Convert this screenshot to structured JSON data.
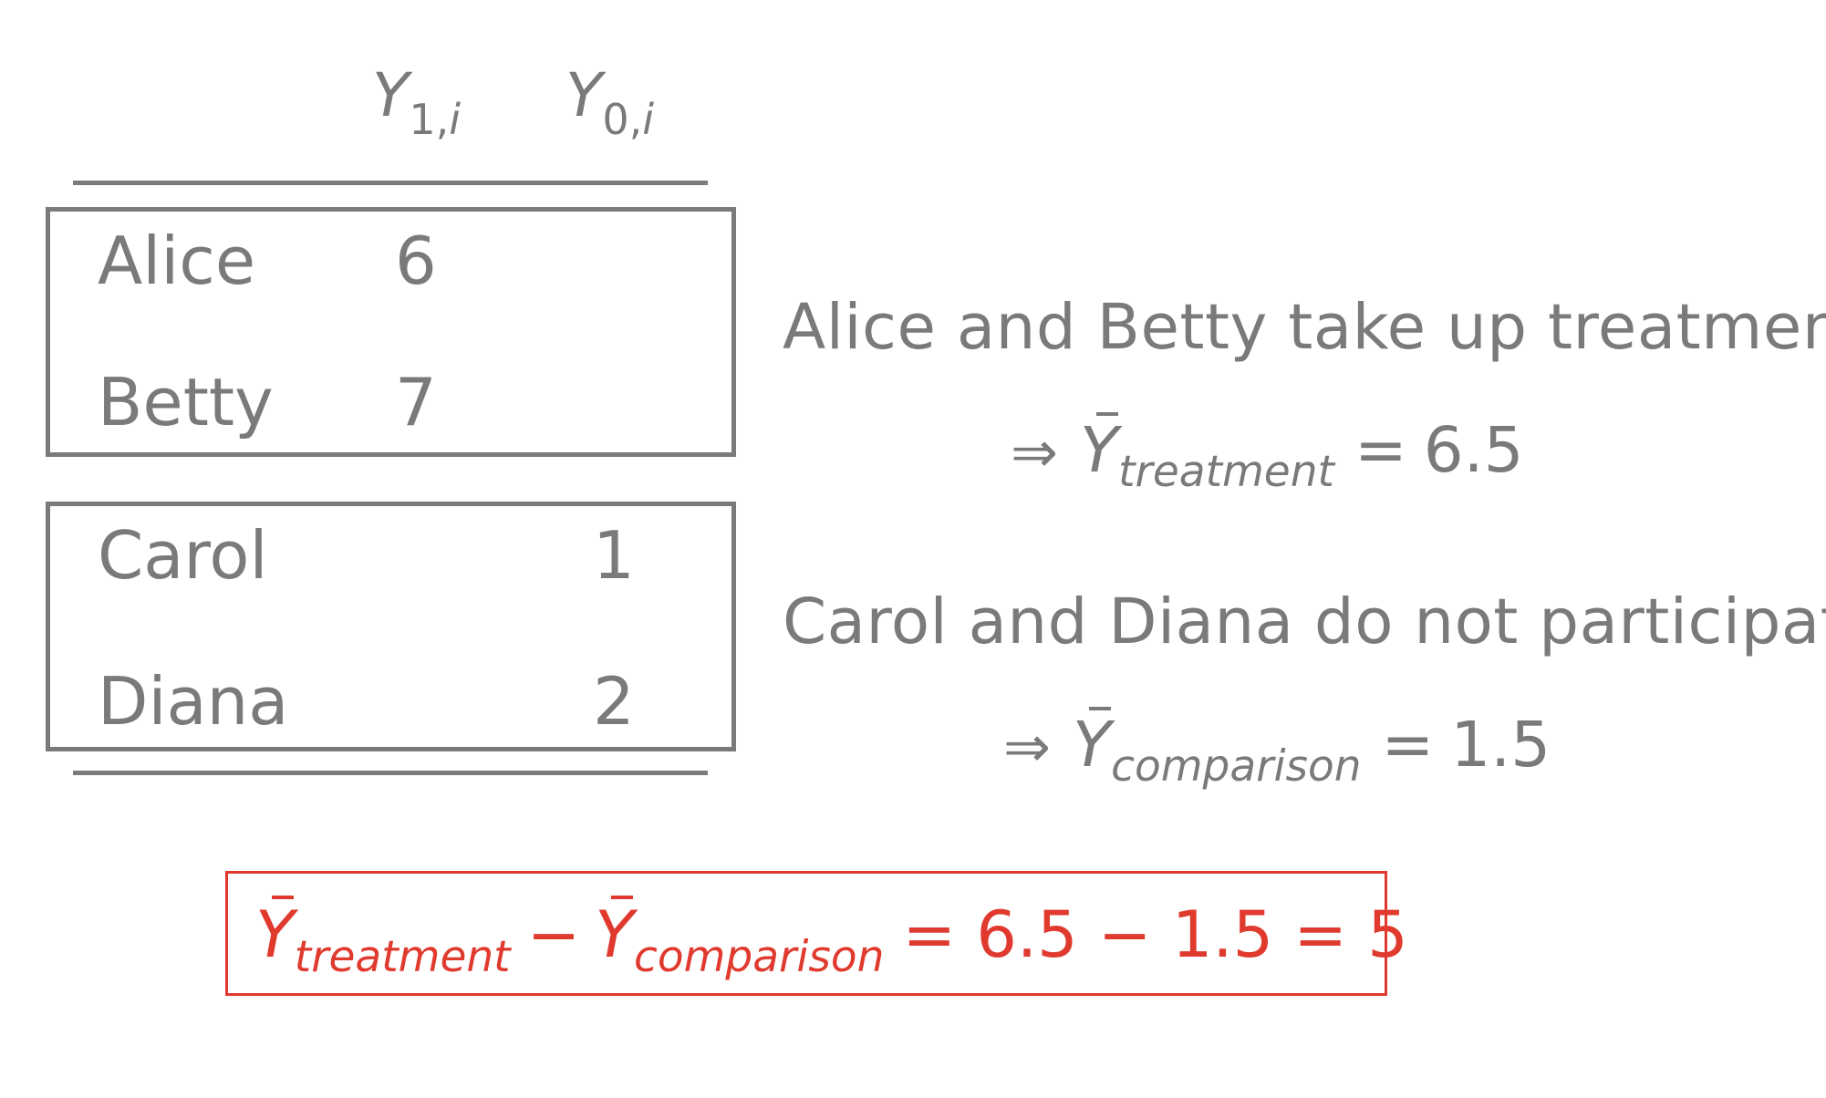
{
  "table": {
    "columns": [
      {
        "symbol": "Y",
        "subscript": "1,",
        "subscript_index": "i"
      },
      {
        "symbol": "Y",
        "subscript": "0,",
        "subscript_index": "i"
      }
    ],
    "groups": [
      {
        "rows": [
          {
            "name": "Alice",
            "y1": "6",
            "y0": ""
          },
          {
            "name": "Betty",
            "y1": "7",
            "y0": ""
          }
        ]
      },
      {
        "rows": [
          {
            "name": "Carol",
            "y1": "",
            "y0": "1"
          },
          {
            "name": "Diana",
            "y1": "",
            "y0": "2"
          }
        ]
      }
    ]
  },
  "annotations": {
    "treatment_text": "Alice and Betty take up treatment",
    "treatment_eq": {
      "arrow": "⇒",
      "symbol": "Y",
      "subscript": "treatment",
      "op": "=",
      "value": "6.5"
    },
    "comparison_text": "Carol and Diana do not participate",
    "comparison_eq": {
      "arrow": "⇒",
      "symbol": "Y",
      "subscript": "comparison",
      "op": "=",
      "value": "1.5"
    }
  },
  "result": {
    "symbol1": "Y",
    "subscript1": "treatment",
    "minus": "−",
    "symbol2": "Y",
    "subscript2": "comparison",
    "expression": "= 6.5 − 1.5 = 5"
  },
  "colors": {
    "text": "#7a7a7a",
    "highlight": "#e03a2e"
  }
}
